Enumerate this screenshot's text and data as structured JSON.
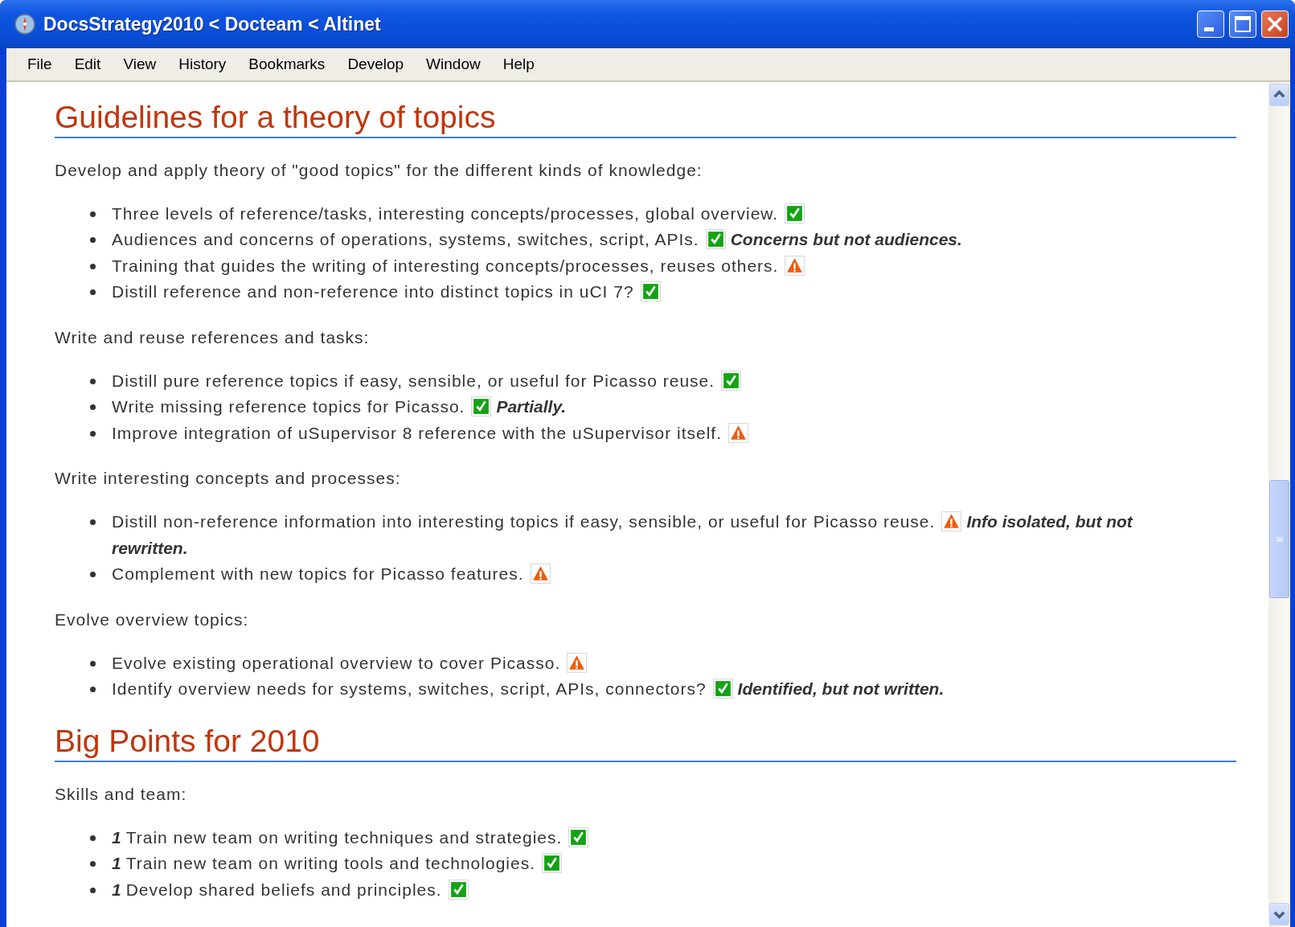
{
  "window": {
    "title": "DocsStrategy2010 < Docteam < Altinet"
  },
  "menu": [
    "File",
    "Edit",
    "View",
    "History",
    "Bookmarks",
    "Develop",
    "Window",
    "Help"
  ],
  "sections": [
    {
      "heading": "Guidelines for a theory of topics",
      "groups": [
        {
          "intro": "Develop and apply theory of \"good topics\" for the different kinds of knowledge:",
          "items": [
            {
              "text": "Three levels of reference/tasks, interesting concepts/processes, global overview.",
              "kind": "check"
            },
            {
              "text": "Audiences and concerns of operations, systems, switches, script, APIs.",
              "kind": "check",
              "note": "Concerns but not audiences."
            },
            {
              "text": "Training that guides the writing of interesting concepts/processes, reuses others.",
              "kind": "warning"
            },
            {
              "text": "Distill reference and non-reference into distinct topics in uCI 7?",
              "kind": "check"
            }
          ]
        },
        {
          "intro": "Write and reuse references and tasks:",
          "items": [
            {
              "text": "Distill pure reference topics if easy, sensible, or useful for Picasso reuse.",
              "kind": "check"
            },
            {
              "text": "Write missing reference topics for Picasso.",
              "kind": "check",
              "note": "Partially."
            },
            {
              "text": "Improve integration of uSupervisor 8 reference with the uSupervisor itself.",
              "kind": "warning"
            }
          ]
        },
        {
          "intro": "Write interesting concepts and processes:",
          "items": [
            {
              "text": "Distill non-reference information into interesting topics if easy, sensible, or useful for Picasso reuse.",
              "kind": "warning",
              "note": "Info isolated, but not rewritten."
            },
            {
              "text": "Complement with new topics for Picasso features.",
              "kind": "warning"
            }
          ]
        },
        {
          "intro": "Evolve overview topics:",
          "items": [
            {
              "text": "Evolve existing operational overview to cover Picasso.",
              "kind": "warning"
            },
            {
              "text": "Identify overview needs for systems, switches, script, APIs, connectors?",
              "kind": "check",
              "note": "Identified, but not written."
            }
          ]
        }
      ]
    },
    {
      "heading": "Big Points for 2010",
      "groups": [
        {
          "intro": "Skills and team:",
          "items": [
            {
              "priority": "1",
              "text": "Train new team on writing techniques and strategies.",
              "kind": "check"
            },
            {
              "priority": "1",
              "text": "Train new team on writing tools and technologies.",
              "kind": "check"
            },
            {
              "priority": "1",
              "text": "Develop shared beliefs and principles.",
              "kind": "check"
            }
          ]
        }
      ]
    }
  ]
}
